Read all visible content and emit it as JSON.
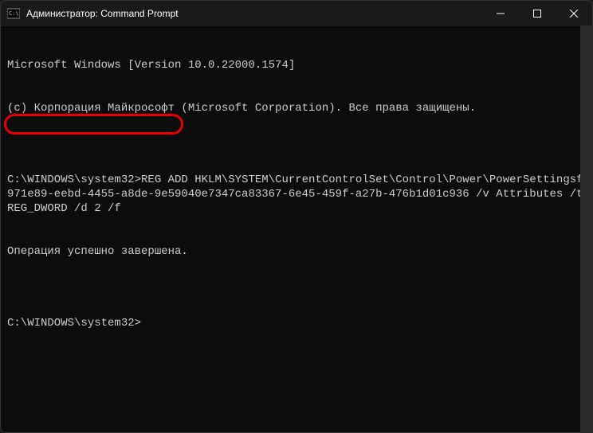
{
  "titlebar": {
    "title": "Администратор: Command Prompt"
  },
  "terminal": {
    "lines": [
      "Microsoft Windows [Version 10.0.22000.1574]",
      "(c) Корпорация Майкрософт (Microsoft Corporation). Все права защищены.",
      "",
      "C:\\WINDOWS\\system32>REG ADD HKLM\\SYSTEM\\CurrentControlSet\\Control\\Power\\PowerSettingsf971e89-eebd-4455-a8de-9e59040e7347ca83367-6e45-459f-a27b-476b1d01c936 /v Attributes /t REG_DWORD /d 2 /f",
      "Операция успешно завершена.",
      "",
      "C:\\WINDOWS\\system32>"
    ],
    "highlighted_text": "Операция успешно завершена."
  }
}
